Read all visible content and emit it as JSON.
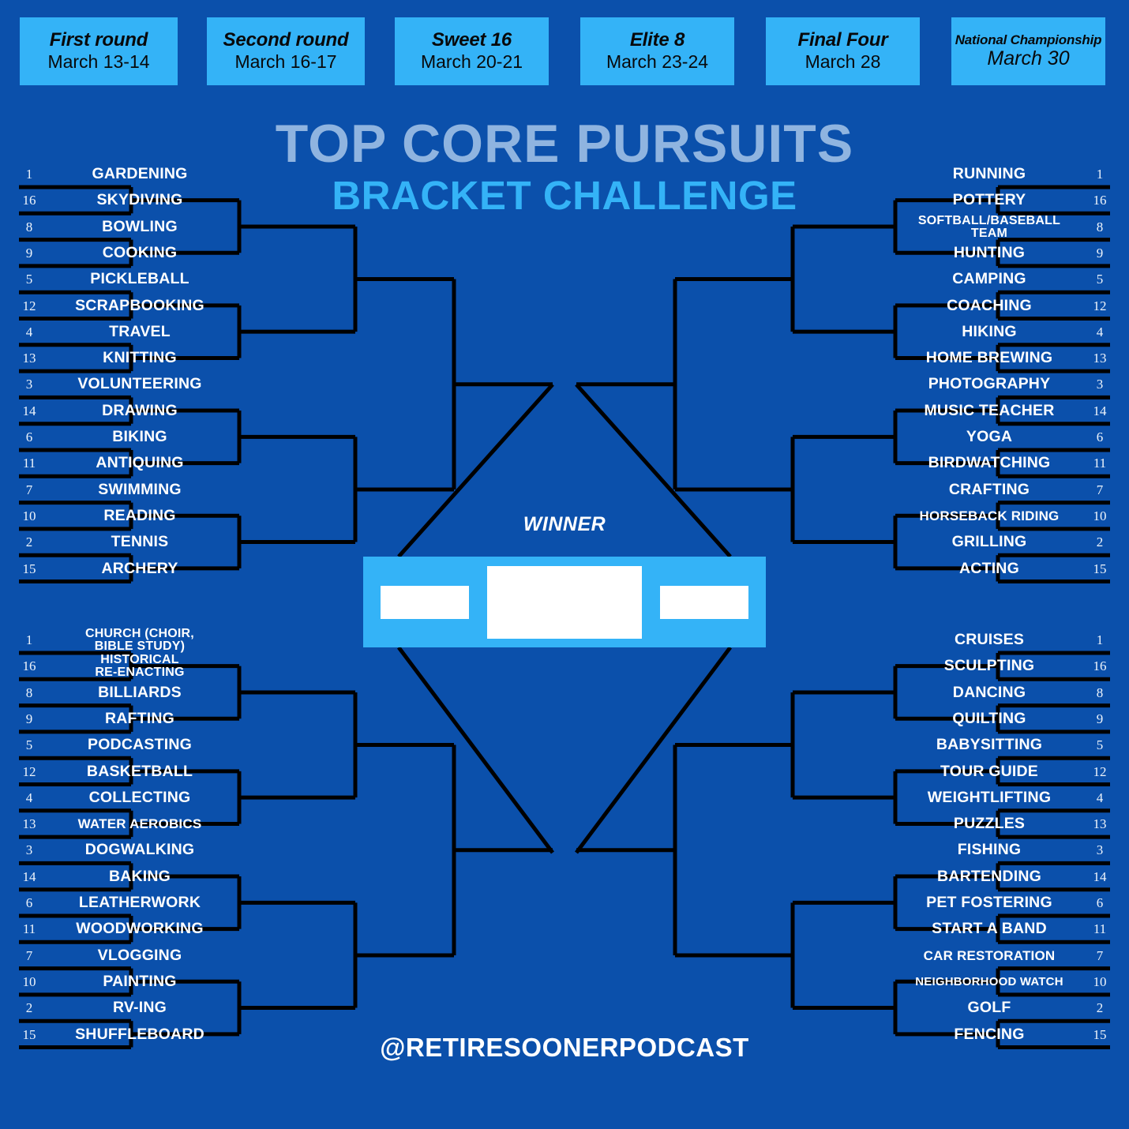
{
  "title": {
    "main": "TOP CORE PURSUITS",
    "sub": "BRACKET CHALLENGE"
  },
  "colors": {
    "background": "#0b50ab",
    "accent": "#34b3f7",
    "title_main": "#8fb4e0",
    "line": "#000000",
    "text": "#ffffff"
  },
  "rounds": [
    {
      "name": "First round",
      "date": "March 13-14"
    },
    {
      "name": "Second round",
      "date": "March 16-17"
    },
    {
      "name": "Sweet 16",
      "date": "March 20-21"
    },
    {
      "name": "Elite 8",
      "date": "March 23-24"
    },
    {
      "name": "Final Four",
      "date": "March 28"
    },
    {
      "name": "National Championship",
      "date": "March 30"
    }
  ],
  "center": {
    "winner_label": "WINNER"
  },
  "footer": {
    "handle": "@RETIRESOONERPODCAST"
  },
  "regions": {
    "top_left": [
      {
        "seed": "1",
        "name": "GARDENING"
      },
      {
        "seed": "16",
        "name": "SKYDIVING"
      },
      {
        "seed": "8",
        "name": "BOWLING"
      },
      {
        "seed": "9",
        "name": "COOKING"
      },
      {
        "seed": "5",
        "name": "PICKLEBALL"
      },
      {
        "seed": "12",
        "name": "SCRAPBOOKING"
      },
      {
        "seed": "4",
        "name": "TRAVEL"
      },
      {
        "seed": "13",
        "name": "KNITTING"
      },
      {
        "seed": "3",
        "name": "VOLUNTEERING"
      },
      {
        "seed": "14",
        "name": "DRAWING"
      },
      {
        "seed": "6",
        "name": "BIKING"
      },
      {
        "seed": "11",
        "name": "ANTIQUING"
      },
      {
        "seed": "7",
        "name": "SWIMMING"
      },
      {
        "seed": "10",
        "name": "READING"
      },
      {
        "seed": "2",
        "name": "TENNIS"
      },
      {
        "seed": "15",
        "name": "ARCHERY"
      }
    ],
    "bottom_left": [
      {
        "seed": "1",
        "name": "CHURCH (CHOIR,\nBIBLE STUDY)"
      },
      {
        "seed": "16",
        "name": "HISTORICAL\nRE-ENACTING"
      },
      {
        "seed": "8",
        "name": "BILLIARDS"
      },
      {
        "seed": "9",
        "name": "RAFTING"
      },
      {
        "seed": "5",
        "name": "PODCASTING"
      },
      {
        "seed": "12",
        "name": "BASKETBALL"
      },
      {
        "seed": "4",
        "name": "COLLECTING"
      },
      {
        "seed": "13",
        "name": "WATER AEROBICS"
      },
      {
        "seed": "3",
        "name": "DOGWALKING"
      },
      {
        "seed": "14",
        "name": "BAKING"
      },
      {
        "seed": "6",
        "name": "LEATHERWORK"
      },
      {
        "seed": "11",
        "name": "WOODWORKING"
      },
      {
        "seed": "7",
        "name": "VLOGGING"
      },
      {
        "seed": "10",
        "name": "PAINTING"
      },
      {
        "seed": "2",
        "name": "RV-ING"
      },
      {
        "seed": "15",
        "name": "SHUFFLEBOARD"
      }
    ],
    "top_right": [
      {
        "seed": "1",
        "name": "RUNNING"
      },
      {
        "seed": "16",
        "name": "POTTERY"
      },
      {
        "seed": "8",
        "name": "SOFTBALL/BASEBALL\nTEAM"
      },
      {
        "seed": "9",
        "name": "HUNTING"
      },
      {
        "seed": "5",
        "name": "CAMPING"
      },
      {
        "seed": "12",
        "name": "COACHING"
      },
      {
        "seed": "4",
        "name": "HIKING"
      },
      {
        "seed": "13",
        "name": "HOME BREWING"
      },
      {
        "seed": "3",
        "name": "PHOTOGRAPHY"
      },
      {
        "seed": "14",
        "name": "MUSIC TEACHER"
      },
      {
        "seed": "6",
        "name": "YOGA"
      },
      {
        "seed": "11",
        "name": "BIRDWATCHING"
      },
      {
        "seed": "7",
        "name": "CRAFTING"
      },
      {
        "seed": "10",
        "name": "HORSEBACK RIDING"
      },
      {
        "seed": "2",
        "name": "GRILLING"
      },
      {
        "seed": "15",
        "name": "ACTING"
      }
    ],
    "bottom_right": [
      {
        "seed": "1",
        "name": "CRUISES"
      },
      {
        "seed": "16",
        "name": "SCULPTING"
      },
      {
        "seed": "8",
        "name": "DANCING"
      },
      {
        "seed": "9",
        "name": "QUILTING"
      },
      {
        "seed": "5",
        "name": "BABYSITTING"
      },
      {
        "seed": "12",
        "name": "TOUR GUIDE"
      },
      {
        "seed": "4",
        "name": "WEIGHTLIFTING"
      },
      {
        "seed": "13",
        "name": "PUZZLES"
      },
      {
        "seed": "3",
        "name": "FISHING"
      },
      {
        "seed": "14",
        "name": "BARTENDING"
      },
      {
        "seed": "6",
        "name": "PET FOSTERING"
      },
      {
        "seed": "11",
        "name": "START A BAND"
      },
      {
        "seed": "7",
        "name": "CAR RESTORATION"
      },
      {
        "seed": "10",
        "name": "NEIGHBORHOOD WATCH"
      },
      {
        "seed": "2",
        "name": "GOLF"
      },
      {
        "seed": "15",
        "name": "FENCING"
      }
    ]
  }
}
